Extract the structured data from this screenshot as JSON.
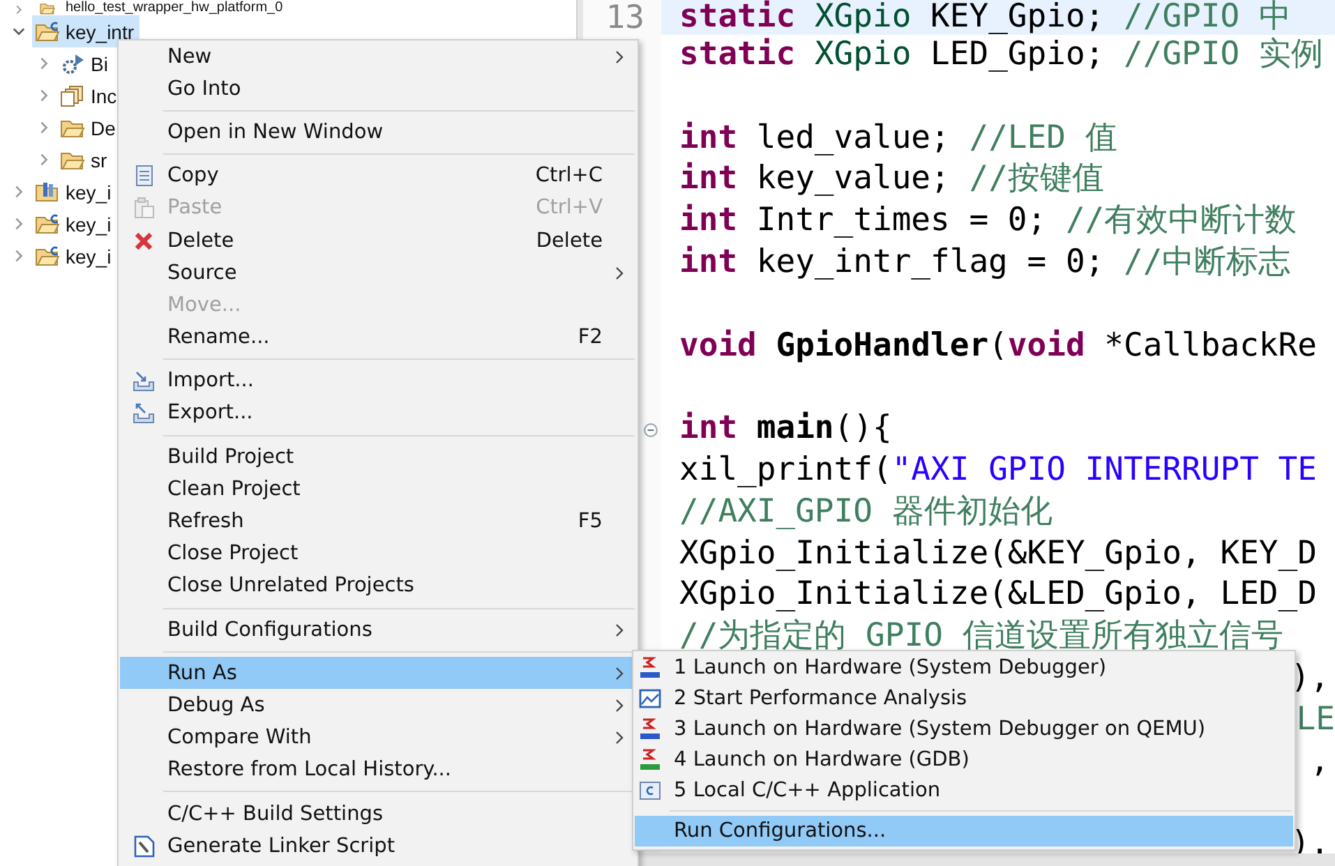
{
  "explorer": {
    "items": [
      {
        "label": "hello_test_wrapper_hw_platform_0",
        "kind": "folder",
        "expanded": false,
        "selected": false
      },
      {
        "label": "key_intr",
        "kind": "project",
        "expanded": true,
        "selected": true,
        "children": [
          {
            "label": "Bi",
            "kind": "binaries",
            "expanded": false,
            "selected": false
          },
          {
            "label": "Inc",
            "kind": "includes",
            "expanded": false,
            "selected": false
          },
          {
            "label": "De",
            "kind": "folder",
            "expanded": false,
            "selected": false
          },
          {
            "label": "sr",
            "kind": "folder",
            "expanded": false,
            "selected": false
          }
        ]
      },
      {
        "label": "key_i",
        "kind": "library",
        "expanded": false,
        "selected": false
      },
      {
        "label": "key_i",
        "kind": "project",
        "expanded": false,
        "selected": false
      },
      {
        "label": "key_i",
        "kind": "project",
        "expanded": false,
        "selected": false
      }
    ]
  },
  "editor": {
    "lines": [
      {
        "kind": "code",
        "current": true,
        "number": "13",
        "tokens": [
          {
            "t": "static",
            "kind": "keyword"
          },
          {
            "t": " XGpio",
            "kind": "type"
          },
          {
            "t": " KEY_Gpio; ",
            "kind": "plain"
          },
          {
            "t": "//GPIO 中",
            "kind": "comment"
          }
        ]
      },
      {
        "kind": "code",
        "current": false,
        "tokens": [
          {
            "t": "static",
            "kind": "keyword"
          },
          {
            "t": " XGpio",
            "kind": "type"
          },
          {
            "t": " LED_Gpio; ",
            "kind": "plain"
          },
          {
            "t": "//GPIO 实例",
            "kind": "comment"
          }
        ]
      },
      {
        "kind": "blank",
        "current": false
      },
      {
        "kind": "code",
        "current": false,
        "tokens": [
          {
            "t": "int",
            "kind": "keyword"
          },
          {
            "t": " led_value; ",
            "kind": "plain"
          },
          {
            "t": "//LED 值",
            "kind": "comment"
          }
        ]
      },
      {
        "kind": "code",
        "current": false,
        "tokens": [
          {
            "t": "int",
            "kind": "keyword"
          },
          {
            "t": " key_value; ",
            "kind": "plain"
          },
          {
            "t": "//按键值",
            "kind": "comment"
          }
        ]
      },
      {
        "kind": "code",
        "current": false,
        "tokens": [
          {
            "t": "int",
            "kind": "keyword"
          },
          {
            "t": " Intr_times = 0; ",
            "kind": "plain"
          },
          {
            "t": "//有效中断计数",
            "kind": "comment"
          }
        ]
      },
      {
        "kind": "code",
        "current": false,
        "tokens": [
          {
            "t": "int",
            "kind": "keyword"
          },
          {
            "t": " key_intr_flag = 0; ",
            "kind": "plain"
          },
          {
            "t": "//中断标志",
            "kind": "comment"
          }
        ]
      },
      {
        "kind": "blank",
        "current": false
      },
      {
        "kind": "code",
        "current": false,
        "tokens": [
          {
            "t": "void",
            "kind": "keyword"
          },
          {
            "t": " GpioHandler",
            "kind": "function"
          },
          {
            "t": "(",
            "kind": "plain"
          },
          {
            "t": "void",
            "kind": "keyword"
          },
          {
            "t": " *CallbackRe",
            "kind": "plain"
          }
        ]
      },
      {
        "kind": "blank",
        "current": false
      },
      {
        "kind": "code",
        "current": false,
        "collapsed": false,
        "tokens": [
          {
            "t": "int",
            "kind": "keyword"
          },
          {
            "t": " main",
            "kind": "function"
          },
          {
            "t": "(){",
            "kind": "plain"
          }
        ]
      },
      {
        "kind": "code",
        "current": false,
        "tokens": [
          {
            "t": "xil_printf(",
            "kind": "plain"
          },
          {
            "t": "\"AXI GPIO INTERRUPT TE",
            "kind": "string"
          }
        ]
      },
      {
        "kind": "code",
        "current": false,
        "tokens": [
          {
            "t": "//AXI_GPIO 器件初始化",
            "kind": "comment"
          }
        ]
      },
      {
        "kind": "code",
        "current": false,
        "tokens": [
          {
            "t": "XGpio_Initialize(&KEY_Gpio, KEY_D",
            "kind": "plain"
          }
        ]
      },
      {
        "kind": "code",
        "current": false,
        "tokens": [
          {
            "t": "XGpio_Initialize(&LED_Gpio, LED_D",
            "kind": "plain"
          }
        ]
      },
      {
        "kind": "code",
        "current": false,
        "tokens": [
          {
            "t": "//为指定的 GPIO 信道设置所有独立信号",
            "kind": "comment"
          }
        ]
      },
      {
        "kind": "tail",
        "current": false,
        "tokens": [
          {
            "t": "),",
            "kind": "plain"
          }
        ]
      },
      {
        "kind": "tail",
        "current": false,
        "tokens": [
          {
            "t": "LE",
            "kind": "comment"
          }
        ]
      },
      {
        "kind": "tail",
        "current": false,
        "tokens": [
          {
            "t": ",",
            "kind": "plain"
          }
        ]
      },
      {
        "kind": "blank",
        "current": false
      },
      {
        "kind": "tail",
        "current": false,
        "tokens": [
          {
            "t": ").",
            "kind": "plain"
          }
        ]
      }
    ]
  },
  "context_menu": {
    "items": [
      {
        "kind": "item",
        "label": "New",
        "submenu": true,
        "disabled": false,
        "selected": false
      },
      {
        "kind": "item",
        "label": "Go Into",
        "submenu": false,
        "disabled": false,
        "selected": false
      },
      {
        "kind": "separator"
      },
      {
        "kind": "item",
        "label": "Open in New Window",
        "submenu": false,
        "disabled": false,
        "selected": false
      },
      {
        "kind": "separator"
      },
      {
        "kind": "item",
        "label": "Copy",
        "shortcut": "Ctrl+C",
        "submenu": false,
        "disabled": false,
        "selected": false
      },
      {
        "kind": "item",
        "label": "Paste",
        "shortcut": "Ctrl+V",
        "submenu": false,
        "disabled": true,
        "selected": false
      },
      {
        "kind": "item",
        "label": "Delete",
        "shortcut": "Delete",
        "submenu": false,
        "disabled": false,
        "selected": false
      },
      {
        "kind": "item",
        "label": "Source",
        "submenu": true,
        "disabled": false,
        "selected": false
      },
      {
        "kind": "item",
        "label": "Move...",
        "submenu": false,
        "disabled": true,
        "selected": false
      },
      {
        "kind": "item",
        "label": "Rename...",
        "shortcut": "F2",
        "submenu": false,
        "disabled": false,
        "selected": false
      },
      {
        "kind": "separator"
      },
      {
        "kind": "item",
        "label": "Import...",
        "submenu": false,
        "disabled": false,
        "selected": false
      },
      {
        "kind": "item",
        "label": "Export...",
        "submenu": false,
        "disabled": false,
        "selected": false
      },
      {
        "kind": "separator"
      },
      {
        "kind": "item",
        "label": "Build Project",
        "submenu": false,
        "disabled": false,
        "selected": false
      },
      {
        "kind": "item",
        "label": "Clean Project",
        "submenu": false,
        "disabled": false,
        "selected": false
      },
      {
        "kind": "item",
        "label": "Refresh",
        "shortcut": "F5",
        "submenu": false,
        "disabled": false,
        "selected": false
      },
      {
        "kind": "item",
        "label": "Close Project",
        "submenu": false,
        "disabled": false,
        "selected": false
      },
      {
        "kind": "item",
        "label": "Close Unrelated Projects",
        "submenu": false,
        "disabled": false,
        "selected": false
      },
      {
        "kind": "separator"
      },
      {
        "kind": "item",
        "label": "Build Configurations",
        "submenu": true,
        "disabled": false,
        "selected": false
      },
      {
        "kind": "separator"
      },
      {
        "kind": "item",
        "label": "Run As",
        "submenu": true,
        "disabled": false,
        "selected": true
      },
      {
        "kind": "item",
        "label": "Debug As",
        "submenu": true,
        "disabled": false,
        "selected": false
      },
      {
        "kind": "item",
        "label": "Compare With",
        "submenu": true,
        "disabled": false,
        "selected": false
      },
      {
        "kind": "item",
        "label": "Restore from Local History...",
        "submenu": false,
        "disabled": false,
        "selected": false
      },
      {
        "kind": "separator"
      },
      {
        "kind": "item",
        "label": "C/C++ Build Settings",
        "submenu": false,
        "disabled": false,
        "selected": false
      },
      {
        "kind": "item",
        "label": "Generate Linker Script",
        "submenu": false,
        "disabled": false,
        "selected": false
      }
    ]
  },
  "submenu": {
    "items": [
      {
        "kind": "item",
        "label": "1 Launch on Hardware (System Debugger)",
        "selected": false
      },
      {
        "kind": "item",
        "label": "2 Start Performance Analysis",
        "selected": false
      },
      {
        "kind": "item",
        "label": "3 Launch on Hardware (System Debugger on QEMU)",
        "selected": false
      },
      {
        "kind": "item",
        "label": "4 Launch on Hardware (GDB)",
        "selected": false
      },
      {
        "kind": "item",
        "label": "5 Local C/C++ Application",
        "selected": false
      },
      {
        "kind": "separator"
      },
      {
        "kind": "item",
        "label": "Run Configurations...",
        "selected": true
      }
    ]
  }
}
